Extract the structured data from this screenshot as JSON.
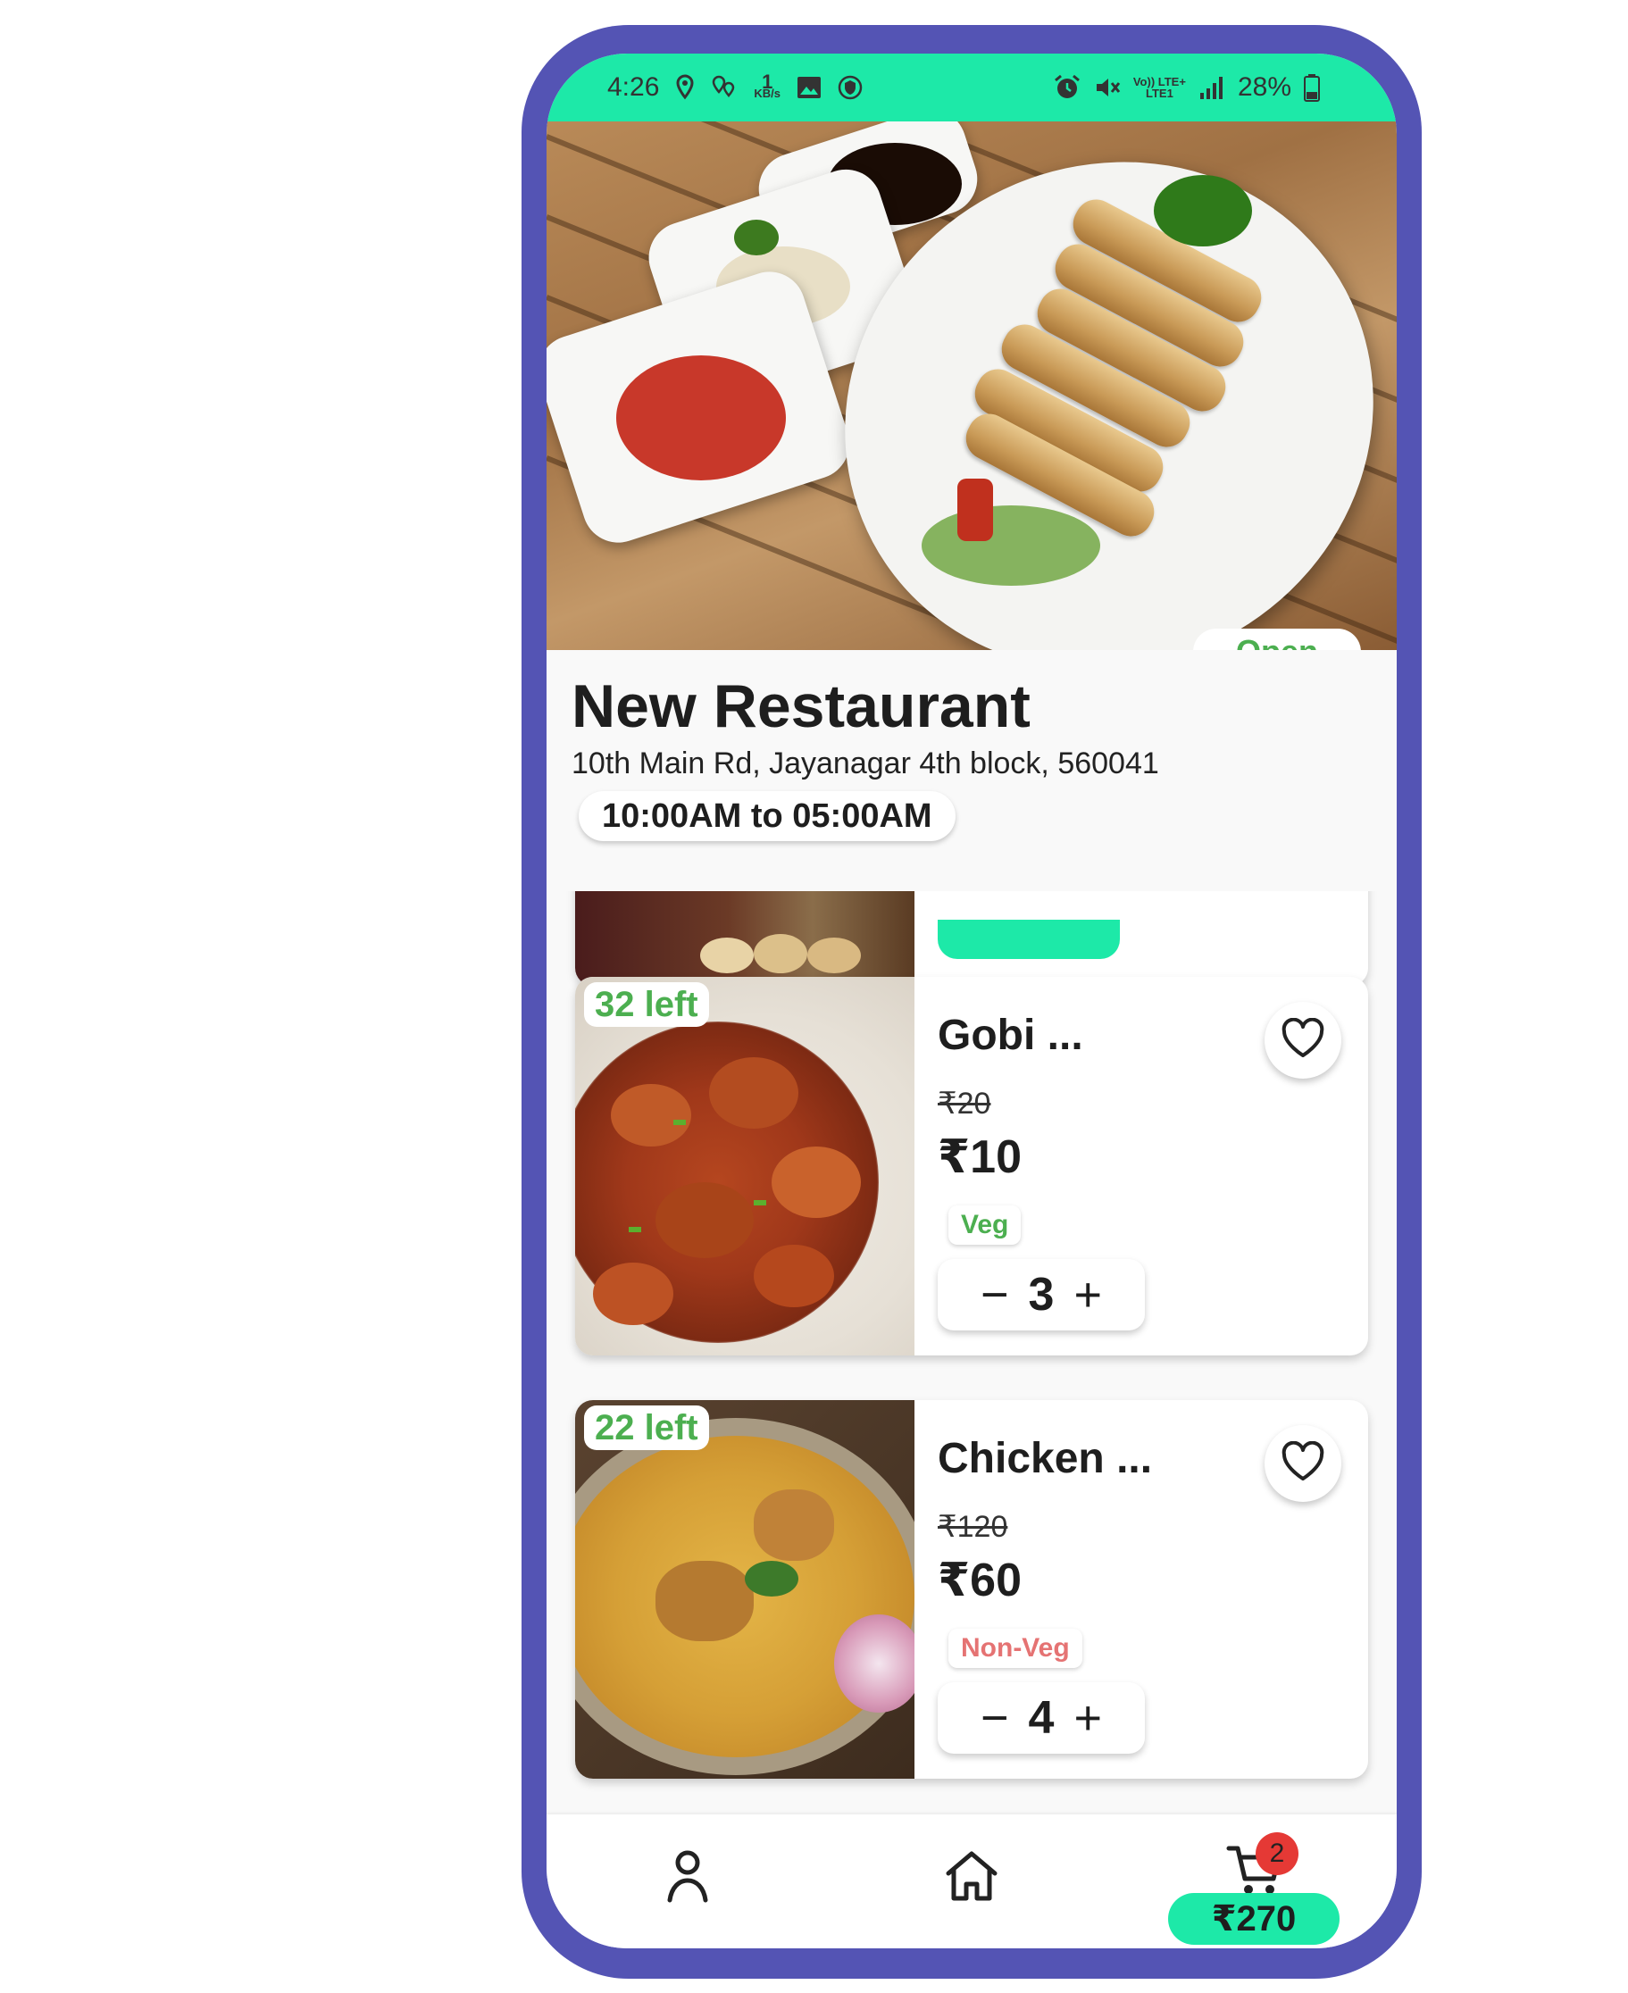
{
  "status_bar": {
    "time": "4:26",
    "speed_value": "1",
    "speed_unit": "KB/s",
    "network_label_top": "Vo)) LTE+",
    "network_label_bottom": "LTE1",
    "battery": "28%",
    "left_icons": [
      "location-icon",
      "location-sharing-icon",
      "image-icon",
      "vpn-shield-icon"
    ],
    "right_icons": [
      "alarm-icon",
      "mute-icon",
      "signal-icon",
      "battery-icon"
    ]
  },
  "restaurant": {
    "status": "Open",
    "name": "New Restaurant",
    "address": "10th Main Rd, Jayanagar 4th block, 560041",
    "hours": "10:00AM to 05:00AM"
  },
  "menu": {
    "items": [
      {
        "stock": "32 left",
        "name": "Gobi ...",
        "mrp": "₹20",
        "price": "₹10",
        "diet": "Veg",
        "diet_color": "#4caf50",
        "quantity": "3",
        "decrement": "−",
        "increment": "+"
      },
      {
        "stock": "22 left",
        "name": "Chicken ...",
        "mrp": "₹120",
        "price": "₹60",
        "diet": "Non-Veg",
        "diet_color": "#e57373",
        "quantity": "4",
        "decrement": "−",
        "increment": "+"
      }
    ]
  },
  "bottom_nav": {
    "items": [
      "profile-icon",
      "home-icon",
      "cart-icon"
    ],
    "cart_count": "2",
    "cart_total": "₹270"
  },
  "colors": {
    "frame": "#5454b4",
    "accent": "#1de9a8",
    "veg": "#4caf50",
    "non_veg": "#e57373",
    "badge_red": "#e53935"
  }
}
